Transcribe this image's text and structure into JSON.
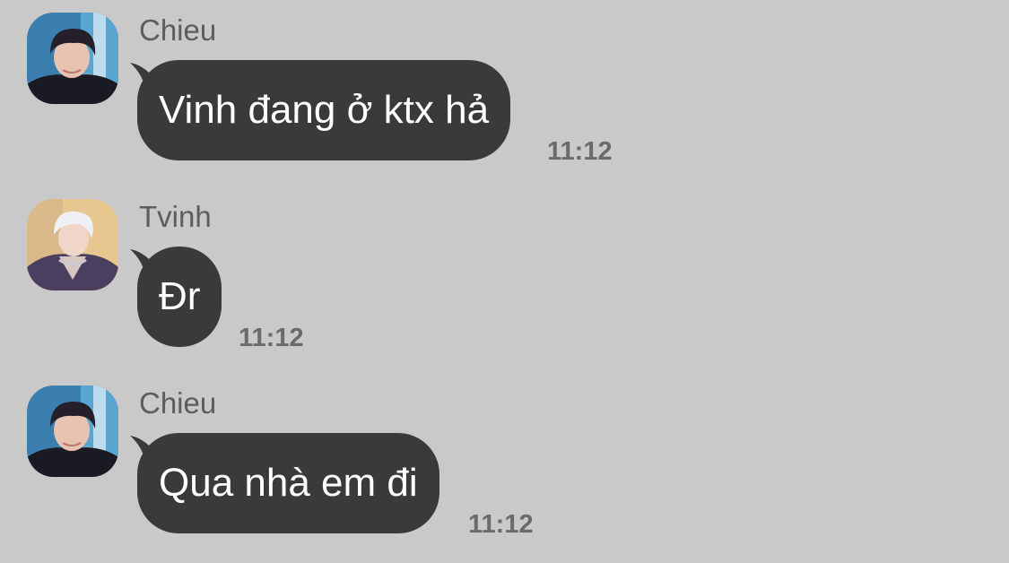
{
  "messages": [
    {
      "sender": "Chieu",
      "avatar": "chieu-avatar",
      "text": "Vinh đang ở ktx hả",
      "time": "11:12"
    },
    {
      "sender": "Tvinh",
      "avatar": "tvinh-avatar",
      "text": "Đr",
      "time": "11:12"
    },
    {
      "sender": "Chieu",
      "avatar": "chieu-avatar",
      "text": "Qua nhà em đi",
      "time": "11:12"
    }
  ],
  "colors": {
    "background": "#c9c9c9",
    "bubble": "#3a3a3c",
    "bubble_text": "#ffffff",
    "sender_text": "#5d5d5d",
    "time_text": "#6a6a6a"
  }
}
